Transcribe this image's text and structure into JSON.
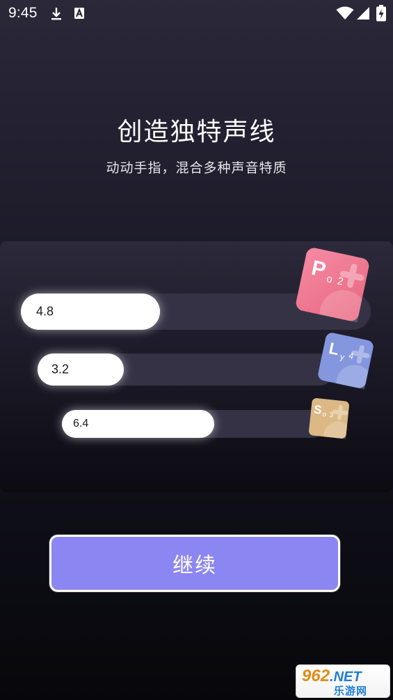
{
  "status_bar": {
    "time": "9:45",
    "icons": [
      "download-icon",
      "font-a-icon",
      "wifi-icon",
      "signal-icon",
      "battery-charging-icon"
    ]
  },
  "header": {
    "title": "创造独特声线",
    "subtitle": "动动手指，混合多种声音特质"
  },
  "sliders": [
    {
      "value_label": "4.8",
      "level": 0.38,
      "tile": {
        "letter": "P",
        "sub": "o",
        "num": "2",
        "color": "#ef7c97",
        "icon": "po-tile-icon"
      }
    },
    {
      "value_label": "3.2",
      "level": 0.3,
      "tile": {
        "letter": "L",
        "sub": "y",
        "num": "4",
        "color": "#8094dc",
        "icon": "ly-tile-icon"
      }
    },
    {
      "value_label": "6.4",
      "level": 0.55,
      "tile": {
        "letter": "S",
        "sub": "o",
        "num": "3",
        "color": "#d9b381",
        "icon": "so-tile-icon"
      }
    }
  ],
  "actions": {
    "continue_label": "继续",
    "continue_color": "#8c86f2"
  },
  "watermark": {
    "top_text": "962",
    "top_suffix": ".NET",
    "bottom_text": "乐游网"
  }
}
